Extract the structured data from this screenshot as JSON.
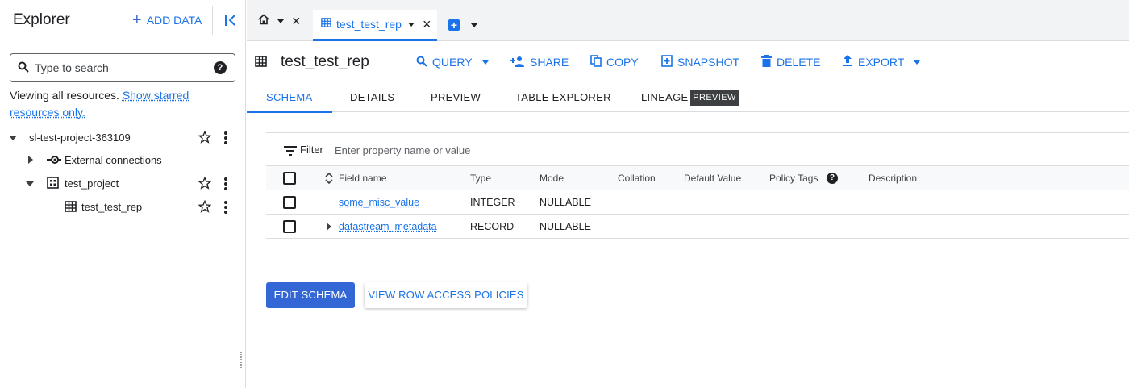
{
  "sidebar": {
    "title": "Explorer",
    "add_data_label": "ADD DATA",
    "search_placeholder": "Type to search",
    "viewing_text": "Viewing all resources.",
    "show_starred_link": "Show starred resources only.",
    "tree": [
      {
        "label": "sl-test-project-363109",
        "level": 0,
        "expanded": true,
        "icon": "none"
      },
      {
        "label": "External connections",
        "level": 1,
        "expanded": false,
        "icon": "external-connections-icon"
      },
      {
        "label": "test_project",
        "level": 1,
        "expanded": true,
        "icon": "dataset-icon"
      },
      {
        "label": "test_test_rep",
        "level": 2,
        "icon": "table-icon"
      }
    ]
  },
  "tabs": {
    "active_tab_label": "test_test_rep"
  },
  "toolbar": {
    "table_title": "test_test_rep",
    "query": "QUERY",
    "share": "SHARE",
    "copy": "COPY",
    "snapshot": "SNAPSHOT",
    "delete": "DELETE",
    "export": "EXPORT"
  },
  "subtabs": {
    "schema": "SCHEMA",
    "details": "DETAILS",
    "preview": "PREVIEW",
    "table_explorer": "TABLE EXPLORER",
    "lineage": "LINEAGE",
    "lineage_badge": "PREVIEW"
  },
  "schema": {
    "filter_label": "Filter",
    "filter_placeholder": "Enter property name or value",
    "columns": [
      "Field name",
      "Type",
      "Mode",
      "Collation",
      "Default Value",
      "Policy Tags",
      "Description"
    ],
    "rows": [
      {
        "field": "some_misc_value",
        "type": "INTEGER",
        "mode": "NULLABLE"
      },
      {
        "field": "datastream_metadata",
        "type": "RECORD",
        "mode": "NULLABLE"
      }
    ]
  },
  "buttons": {
    "edit_schema": "EDIT SCHEMA",
    "view_row_access": "VIEW ROW ACCESS POLICIES"
  },
  "colors": {
    "accent": "#1a73e8",
    "primary_button": "#3367d6"
  }
}
